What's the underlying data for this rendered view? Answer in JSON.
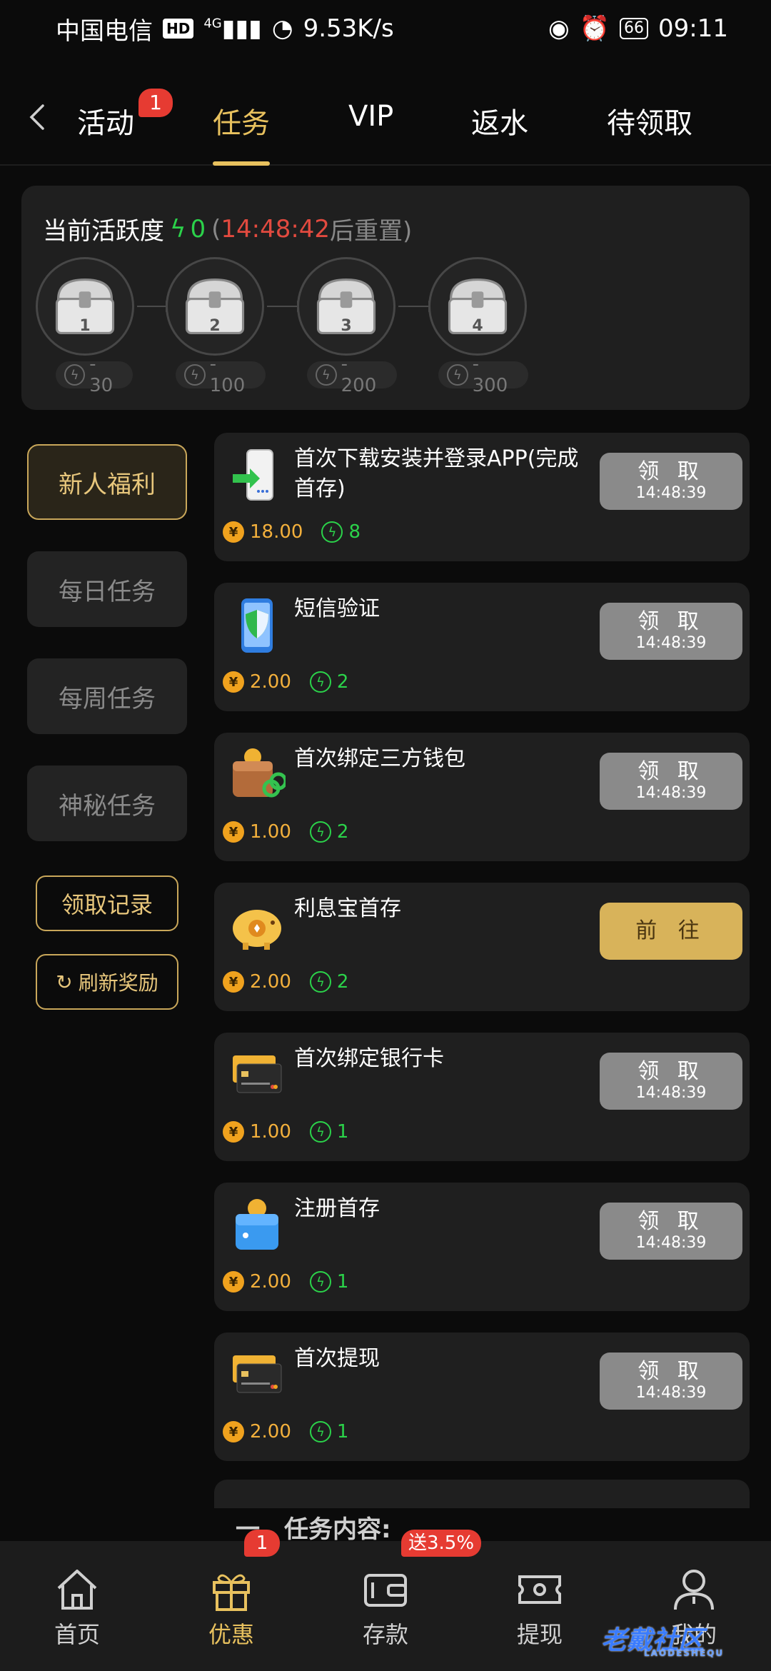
{
  "status_bar": {
    "carrier": "中国电信",
    "hd": "HD",
    "network": "4G",
    "speed": "9.53K/s",
    "battery": "66",
    "time": "09:11"
  },
  "top_nav": {
    "tabs": [
      {
        "label": "活动",
        "badge": "1"
      },
      {
        "label": "任务"
      },
      {
        "label": "VIP"
      },
      {
        "label": "返水"
      },
      {
        "label": "待领取"
      }
    ],
    "active_tab": "任务"
  },
  "activity": {
    "title": "当前活跃度",
    "value": "0",
    "paren_open": "(",
    "countdown": "14:48:42",
    "reset_suffix": "后重置)",
    "chests": [
      {
        "num": "1",
        "requirement": "- 30"
      },
      {
        "num": "2",
        "requirement": "- 100"
      },
      {
        "num": "3",
        "requirement": "- 200"
      },
      {
        "num": "4",
        "requirement": "- 300"
      }
    ]
  },
  "sidebar": {
    "items": [
      {
        "label": "新人福利",
        "active": true
      },
      {
        "label": "每日任务"
      },
      {
        "label": "每周任务"
      },
      {
        "label": "神秘任务"
      }
    ],
    "record_label": "领取记录",
    "refresh_label": "刷新奖励"
  },
  "tasks": [
    {
      "title": "首次下载安装并登录APP(完成首存)",
      "amount": "18.00",
      "points": "8",
      "button": "领 取",
      "countdown": "14:48:39",
      "icon": "phone-download-icon"
    },
    {
      "title": "短信验证",
      "amount": "2.00",
      "points": "2",
      "button": "领 取",
      "countdown": "14:48:39",
      "icon": "phone-shield-icon"
    },
    {
      "title": "首次绑定三方钱包",
      "amount": "1.00",
      "points": "2",
      "button": "领 取",
      "countdown": "14:48:39",
      "icon": "wallet-link-icon"
    },
    {
      "title": "利息宝首存",
      "amount": "2.00",
      "points": "2",
      "button": "前 往",
      "countdown": "",
      "icon": "piggy-bank-icon"
    },
    {
      "title": "首次绑定银行卡",
      "amount": "1.00",
      "points": "1",
      "button": "领 取",
      "countdown": "14:48:39",
      "icon": "bank-card-icon"
    },
    {
      "title": "注册首存",
      "amount": "2.00",
      "points": "1",
      "button": "领 取",
      "countdown": "14:48:39",
      "icon": "wallet-coin-icon"
    },
    {
      "title": "首次提现",
      "amount": "2.00",
      "points": "1",
      "button": "领 取",
      "countdown": "14:48:39",
      "icon": "bank-card-icon"
    }
  ],
  "partial_text": "一、任务内容:",
  "coin_symbol": "¥",
  "bottom_nav": {
    "items": [
      {
        "label": "首页",
        "icon": "home-icon"
      },
      {
        "label": "优惠",
        "icon": "gift-icon",
        "badge": "1"
      },
      {
        "label": "存款",
        "icon": "deposit-wallet-icon",
        "badge": "送3.5%"
      },
      {
        "label": "提现",
        "icon": "withdraw-ticket-icon"
      },
      {
        "label": "我的",
        "icon": "profile-icon"
      }
    ]
  },
  "watermark": {
    "text": "老戴社区",
    "sub": "LAODESHEQU"
  },
  "colors": {
    "accent": "#e8c15e",
    "green": "#2bd24a",
    "red": "#e24a3f",
    "card": "#1f1f1f"
  }
}
